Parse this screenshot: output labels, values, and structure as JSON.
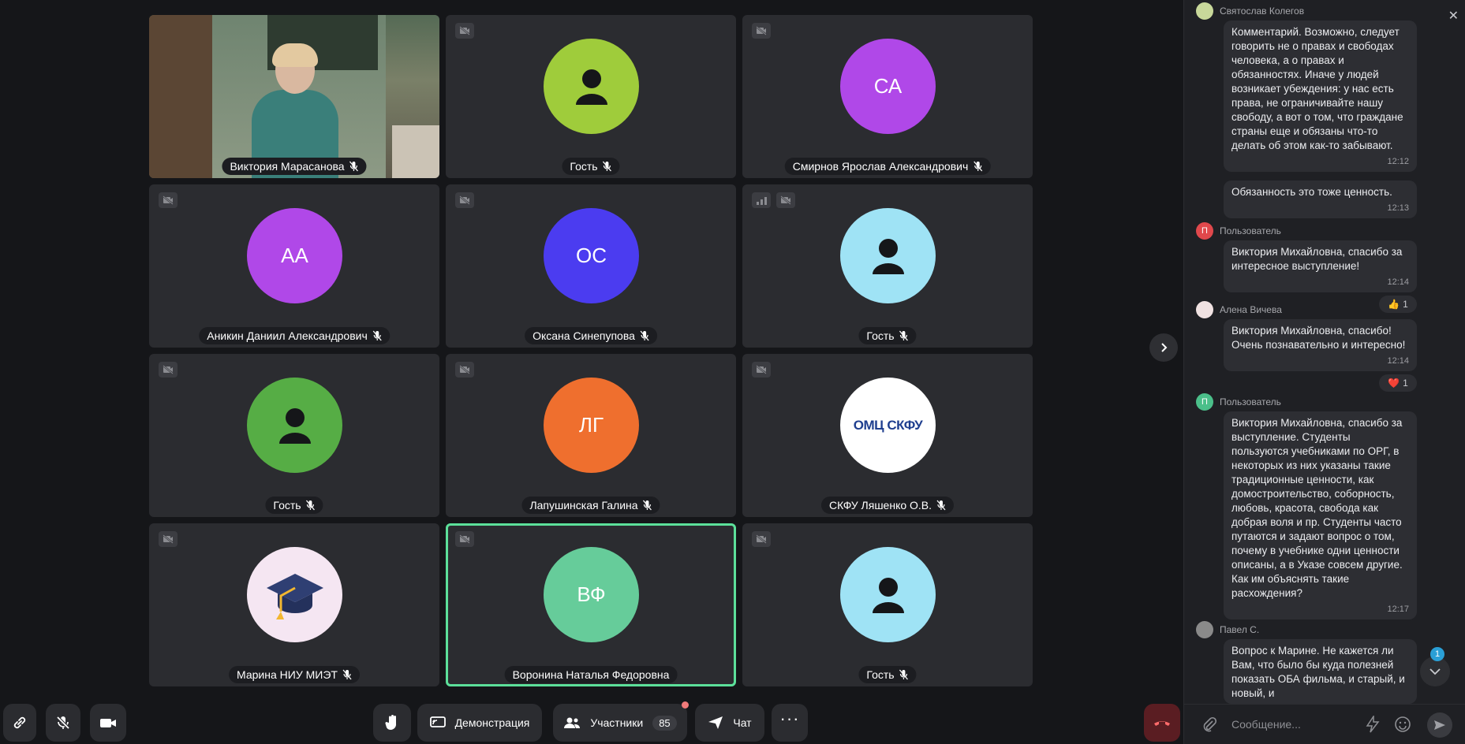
{
  "tiles": [
    {
      "name": "Виктория Марасанова",
      "initials": "",
      "color": "",
      "kind": "video"
    },
    {
      "name": "Гость",
      "initials": "",
      "color": "#9fcc3b",
      "kind": "person"
    },
    {
      "name": "Смирнов Ярослав Александрович",
      "initials": "СА",
      "color": "#b048e8",
      "kind": "initials"
    },
    {
      "name": "Аникин Даниил Александрович",
      "initials": "АА",
      "color": "#b048e8",
      "kind": "initials"
    },
    {
      "name": "Оксана Синепупова",
      "initials": "ОС",
      "color": "#4b3cf0",
      "kind": "initials"
    },
    {
      "name": "Гость",
      "initials": "",
      "color": "#9fe3f5",
      "kind": "person"
    },
    {
      "name": "Гость",
      "initials": "",
      "color": "#56ad45",
      "kind": "person"
    },
    {
      "name": "Лапушинская Галина",
      "initials": "ЛГ",
      "color": "#ef6f2e",
      "kind": "initials"
    },
    {
      "name": "СКФУ Ляшенко О.В.",
      "initials": "",
      "color": "#ffffff",
      "kind": "logo"
    },
    {
      "name": "Марина НИУ МИЭТ",
      "initials": "",
      "color": "#f5e6f2",
      "kind": "cap"
    },
    {
      "name": "Воронина Наталья Федоровна",
      "initials": "ВФ",
      "color": "#66cc9a",
      "kind": "initials"
    },
    {
      "name": "Гость",
      "initials": "",
      "color": "#9fe3f5",
      "kind": "person"
    }
  ],
  "logo_text": "ОМЦ СКФУ",
  "toolbar": {
    "demo_label": "Демонстрация",
    "participants_label": "Участники",
    "participants_count": "85",
    "chat_label": "Чат"
  },
  "chat": {
    "messages": [
      {
        "author": "Святослав Колегов",
        "avatar_letter": "",
        "avatar_color": "#c8d89a",
        "text": "Комментарий. Возможно, следует говорить не о правах и свободах человека, а о правах и обязанностях. Иначе у людей возникает убеждения: у нас есть права, не ограничивайте нашу свободу, а  вот о том, что граждане страны еще и обязаны что-то делать об этом как-то забывают.",
        "time": "12:12"
      },
      {
        "author": "",
        "avatar_letter": "",
        "avatar_color": "",
        "text": "Обязанность это тоже ценность.",
        "time": "12:13"
      },
      {
        "author": "Пользователь",
        "avatar_letter": "П",
        "avatar_color": "#e0484c",
        "text": "Виктория Михайловна, спасибо за интересное выступление!",
        "time": "12:14",
        "reaction": "👍",
        "reaction_count": "1"
      },
      {
        "author": "Алена Вичева",
        "avatar_letter": "",
        "avatar_color": "#f0e2e2",
        "text": "Виктория Михайловна, спасибо! Очень познавательно и интересно!",
        "time": "12:14",
        "reaction": "❤️",
        "reaction_count": "1"
      },
      {
        "author": "Пользователь",
        "avatar_letter": "П",
        "avatar_color": "#4bbf8a",
        "text": "Виктория Михайловна, спасибо за выступление. Студенты пользуются учебниками по ОРГ, в некоторых из них указаны такие традиционные ценности, как домостроительство, соборность, любовь, красота, свобода как добрая воля и пр. Студенты часто путаются и задают вопрос о том, почему в учебнике одни ценности описаны, а в Указе совсем другие. Как им объяснять такие расхождения?",
        "time": "12:17"
      },
      {
        "author": "Павел С.",
        "avatar_letter": "",
        "avatar_color": "#8a8a8a",
        "text": "Вопрос к Марине. Не кажется ли Вам, что было бы куда полезней показать ОБА фильма, и старый, и новый, и",
        "time": ""
      }
    ],
    "composer_placeholder": "Сообщение...",
    "unread_count": "1"
  }
}
